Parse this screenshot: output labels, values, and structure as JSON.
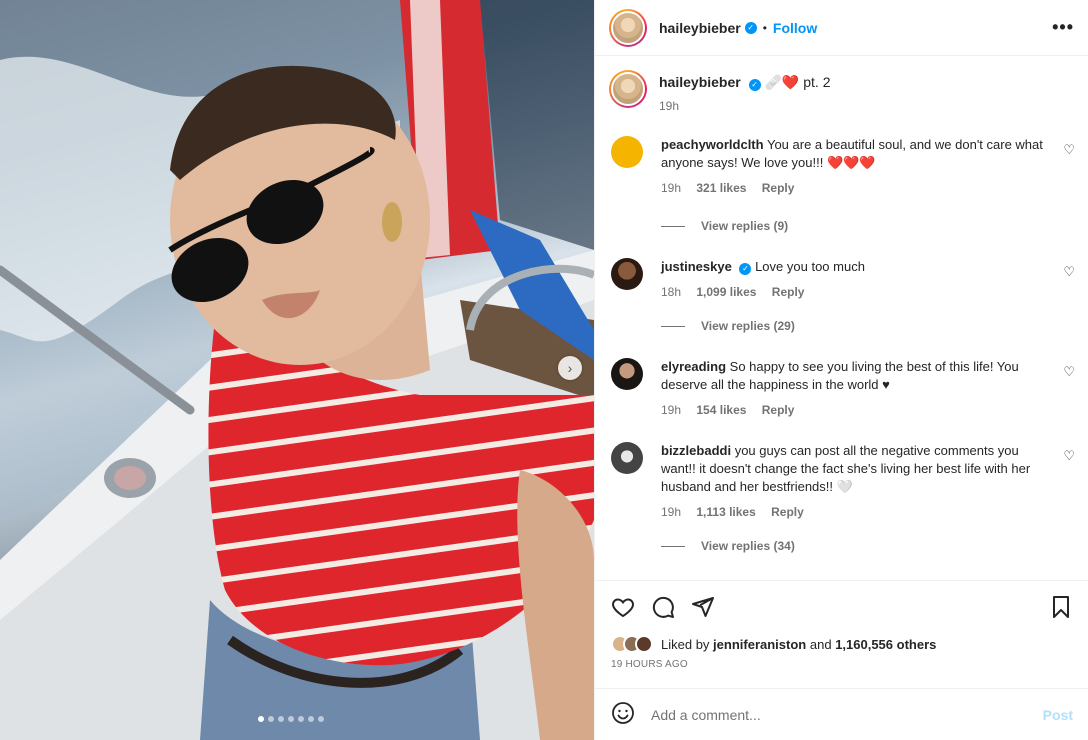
{
  "post": {
    "author": "haileybieber",
    "follow_label": "Follow",
    "separator": "•",
    "more_label": "•••",
    "caption_emojis": "🩹❤️",
    "caption_text": "pt. 2",
    "caption_time": "19h",
    "carousel": {
      "total_slides": 7,
      "active_slide": 1
    }
  },
  "comments": [
    {
      "user": "peachyworldclth",
      "verified": false,
      "text": "You are a beautiful soul, and we don't care what anyone says! We love you!!! ❤️❤️❤️",
      "time": "19h",
      "likes": "321 likes",
      "reply": "Reply",
      "view_replies": "View replies (9)"
    },
    {
      "user": "justineskye",
      "verified": true,
      "text": "Love you too much",
      "time": "18h",
      "likes": "1,099 likes",
      "reply": "Reply",
      "view_replies": "View replies (29)"
    },
    {
      "user": "elyreading",
      "verified": false,
      "text": "So happy to see you living the best of this life! You deserve all the happiness in the world ♥",
      "time": "19h",
      "likes": "154 likes",
      "reply": "Reply"
    },
    {
      "user": "bizzlebaddi",
      "verified": false,
      "text": "you guys can post all the negative comments you want!! it doesn't change the fact she's living her best life with her husband and her bestfriends!! 🤍",
      "time": "19h",
      "likes": "1,113 likes",
      "reply": "Reply",
      "view_replies": "View replies (34)"
    }
  ],
  "engagement": {
    "liked_by_prefix": "Liked by",
    "liked_by_user": "jenniferaniston",
    "and_text": "and",
    "others_count": "1,160,556 others",
    "time_ago": "19 HOURS AGO"
  },
  "comment_input": {
    "placeholder": "Add a comment...",
    "post_label": "Post"
  },
  "icons": [
    "heart-icon",
    "comment-icon",
    "share-icon",
    "bookmark-icon",
    "emoji-icon",
    "verified-icon",
    "chevron-right-icon",
    "more-icon"
  ],
  "colors": {
    "accent": "#0095f6",
    "post_disabled": "#b2dffc",
    "muted": "#737373",
    "stripe_red": "#e0262d"
  }
}
